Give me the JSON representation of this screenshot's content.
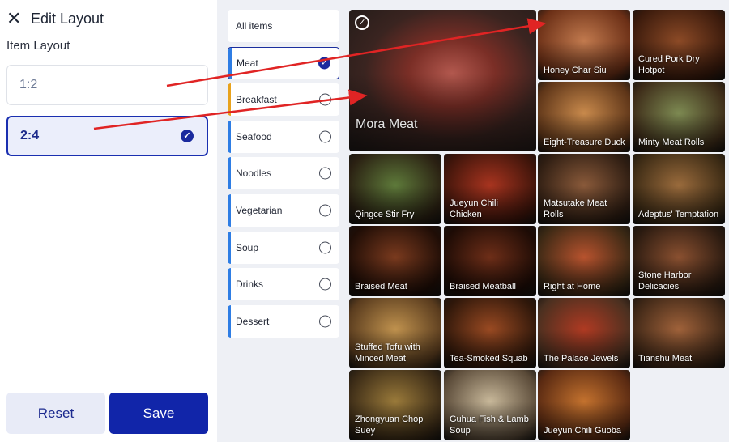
{
  "header": {
    "title": "Edit Layout",
    "close_icon": "close-icon"
  },
  "layout_section": {
    "label": "Item Layout",
    "options": [
      {
        "label": "1:2",
        "selected": false
      },
      {
        "label": "2:4",
        "selected": true
      }
    ]
  },
  "buttons": {
    "reset": "Reset",
    "save": "Save"
  },
  "categories": [
    {
      "label": "All items",
      "selected": false,
      "accent": ""
    },
    {
      "label": "Meat",
      "selected": true,
      "accent": "#2e7de4"
    },
    {
      "label": "Breakfast",
      "selected": false,
      "accent": "#e8a21c"
    },
    {
      "label": "Seafood",
      "selected": false,
      "accent": "#2e7de4"
    },
    {
      "label": "Noodles",
      "selected": false,
      "accent": "#2e7de4"
    },
    {
      "label": "Vegetarian",
      "selected": false,
      "accent": "#2e7de4"
    },
    {
      "label": "Soup",
      "selected": false,
      "accent": "#2e7de4"
    },
    {
      "label": "Drinks",
      "selected": false,
      "accent": "#2e7de4"
    },
    {
      "label": "Dessert",
      "selected": false,
      "accent": "#2e7de4"
    }
  ],
  "featured": {
    "label": "Mora Meat",
    "selected": true
  },
  "items": [
    "Honey Char Siu",
    "Cured Pork Dry Hotpot",
    "Eight-Treasure Duck",
    "Minty Meat Rolls",
    "Qingce Stir Fry",
    "Jueyun Chili Chicken",
    "Matsutake Meat Rolls",
    "Adeptus' Temptation",
    "Braised Meat",
    "Braised Meatball",
    "Right at Home",
    "Stone Harbor Delicacies",
    "Stuffed Tofu with Minced Meat",
    "Tea-Smoked Squab",
    "The Palace Jewels",
    "Tianshu Meat",
    "Zhongyuan Chop Suey",
    "Guhua Fish & Lamb Soup",
    "Jueyun Chili Guoba"
  ],
  "colors": {
    "primary": "#1125a9",
    "annotation_arrow": "#e02424"
  }
}
